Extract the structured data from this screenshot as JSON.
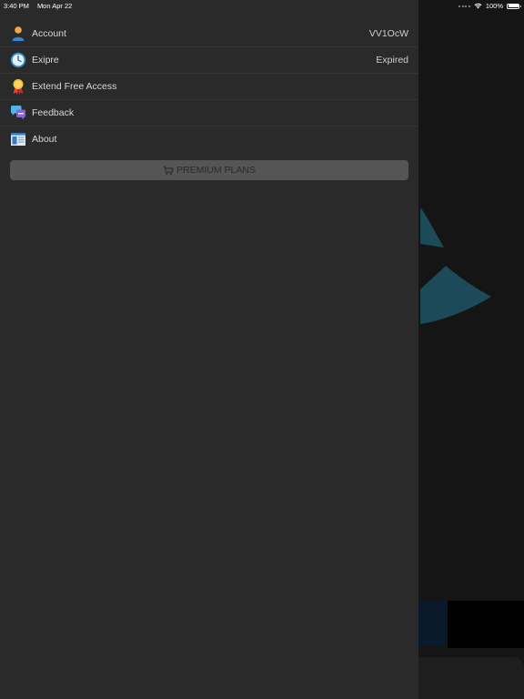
{
  "status_bar": {
    "time": "3:40 PM",
    "date": "Mon Apr 22",
    "battery": "100%",
    "battery_level": 1.0
  },
  "menu": {
    "items": [
      {
        "label": "Account",
        "value": "VV1OcW",
        "icon": "user-icon"
      },
      {
        "label": "Exipre",
        "value": "Expired",
        "icon": "clock-icon"
      },
      {
        "label": "Extend Free Access",
        "value": "",
        "icon": "award-ribbon-icon"
      },
      {
        "label": "Feedback",
        "value": "",
        "icon": "chat-bubbles-icon"
      },
      {
        "label": "About",
        "value": "",
        "icon": "info-page-icon"
      }
    ]
  },
  "premium_button": {
    "label": "PREMIUM PLANS",
    "icon": "cart-icon"
  },
  "colors": {
    "drawer_bg": "#2a2a2a",
    "button_bg": "#555555",
    "accent_teal": "#1a4a5a",
    "banner_text_red": "#d0433b"
  }
}
